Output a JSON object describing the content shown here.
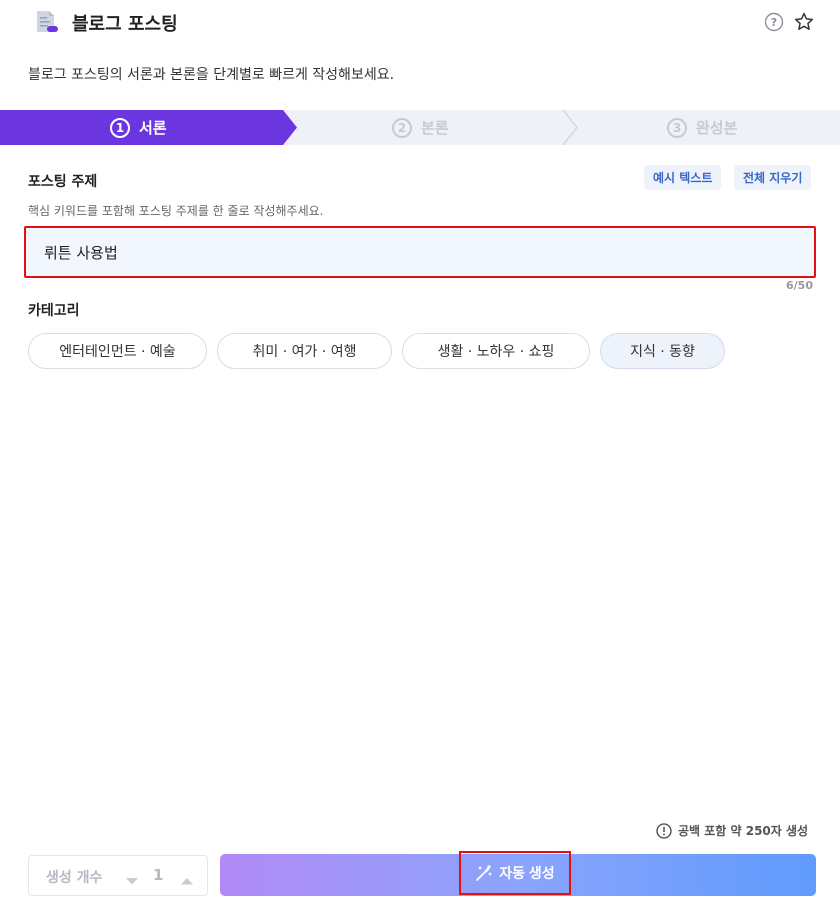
{
  "header": {
    "title": "블로그 포스팅",
    "icons": {
      "app": "document-icon",
      "help": "help-circle-icon",
      "favorite": "star-outline-icon"
    }
  },
  "subtitle": "블로그 포스팅의 서론과 본론을 단계별로 빠르게 작성해보세요.",
  "steps": [
    {
      "number": "1",
      "label": "서론",
      "active": true
    },
    {
      "number": "2",
      "label": "본론",
      "active": false
    },
    {
      "number": "3",
      "label": "완성본",
      "active": false
    }
  ],
  "topic": {
    "label": "포스팅 주제",
    "help": "핵심 키워드를 포함해 포스팅 주제를 한 줄로 작성해주세요.",
    "example_button": "예시 텍스트",
    "clear_button": "전체 지우기",
    "value": "뤼튼 사용법",
    "counter": "6/50"
  },
  "category": {
    "label": "카테고리",
    "options": [
      {
        "label": "엔터테인먼트 · 예술",
        "selected": false
      },
      {
        "label": "취미 · 여가 · 여행",
        "selected": false
      },
      {
        "label": "생활 · 노하우 · 쇼핑",
        "selected": false
      },
      {
        "label": "지식 · 동향",
        "selected": true
      }
    ]
  },
  "footer": {
    "notice": "공백 포함 약 250자 생성",
    "count_label": "생성 개수",
    "count_value": "1",
    "generate_button": "자동 생성"
  },
  "colors": {
    "active_step": "#6b36e0",
    "highlight": "#e31010",
    "chip_text": "#3867c8",
    "input_bg": "#f2f6ff"
  }
}
